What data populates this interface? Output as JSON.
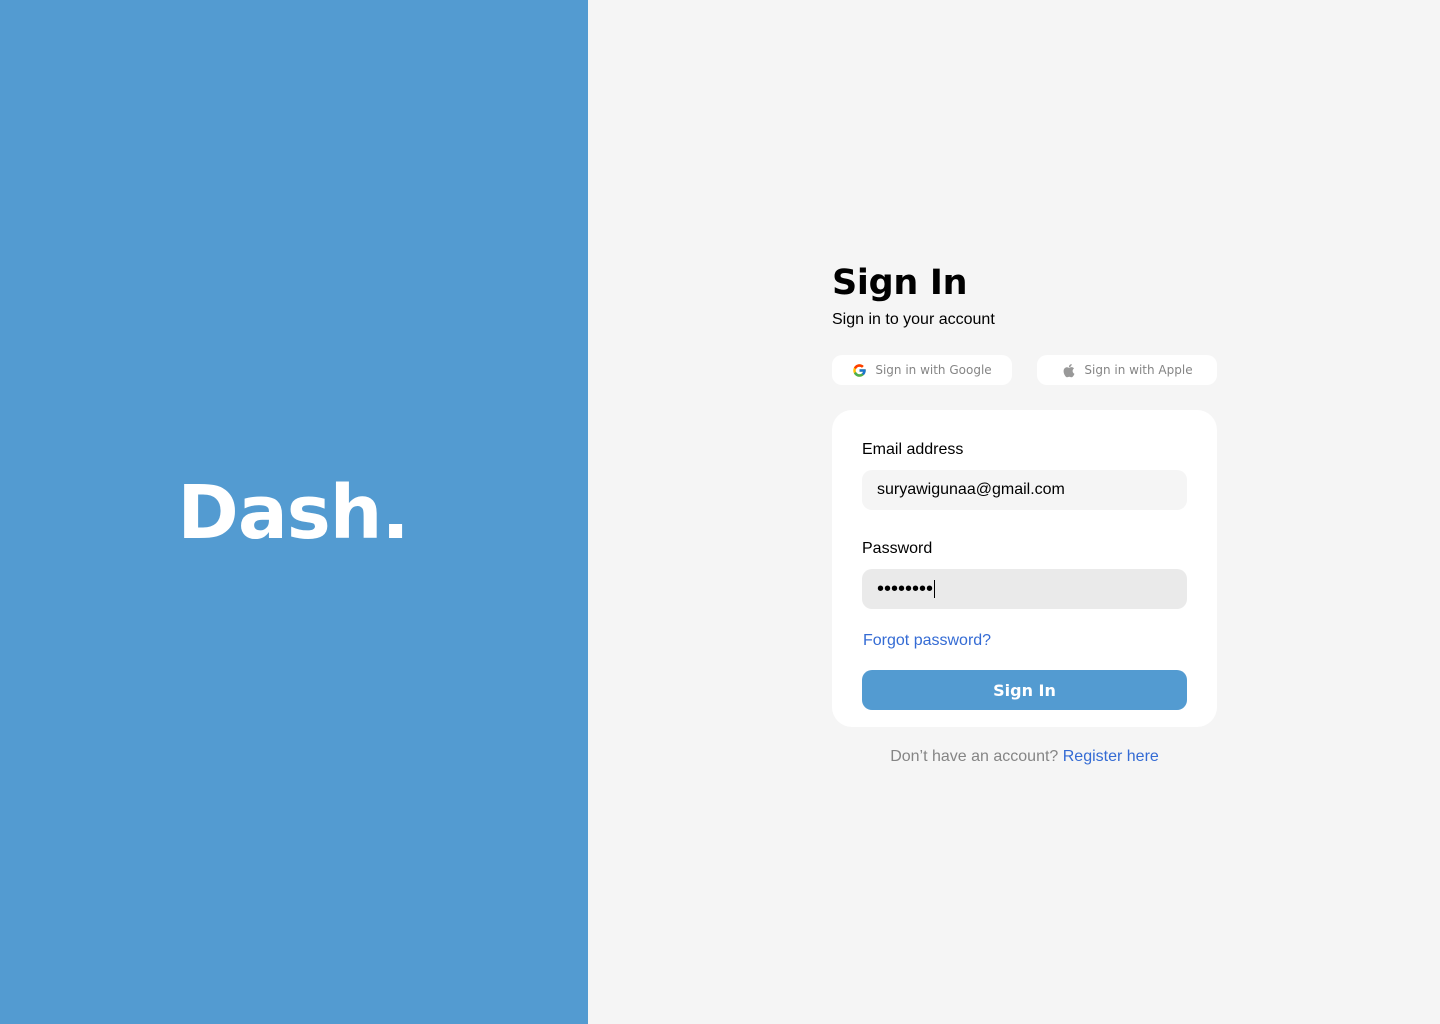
{
  "brand": {
    "name": "Dash."
  },
  "signin": {
    "title": "Sign In",
    "subtitle": "Sign in to your account",
    "social": {
      "google_label": "Sign in with Google",
      "apple_label": "Sign in with Apple"
    },
    "email": {
      "label": "Email address",
      "value": "suryawigunaa@gmail.com"
    },
    "password": {
      "label": "Password",
      "masked_value": "••••••••"
    },
    "forgot_label": "Forgot password?",
    "submit_label": "Sign In",
    "register": {
      "prompt": "Don’t have an account?",
      "link_label": "Register here"
    }
  },
  "colors": {
    "brand_blue": "#539BD1",
    "background": "#F5F5F5",
    "link_blue": "#346BD4",
    "muted_text": "#858585"
  },
  "icons": {
    "google": "google-icon",
    "apple": "apple-icon"
  }
}
